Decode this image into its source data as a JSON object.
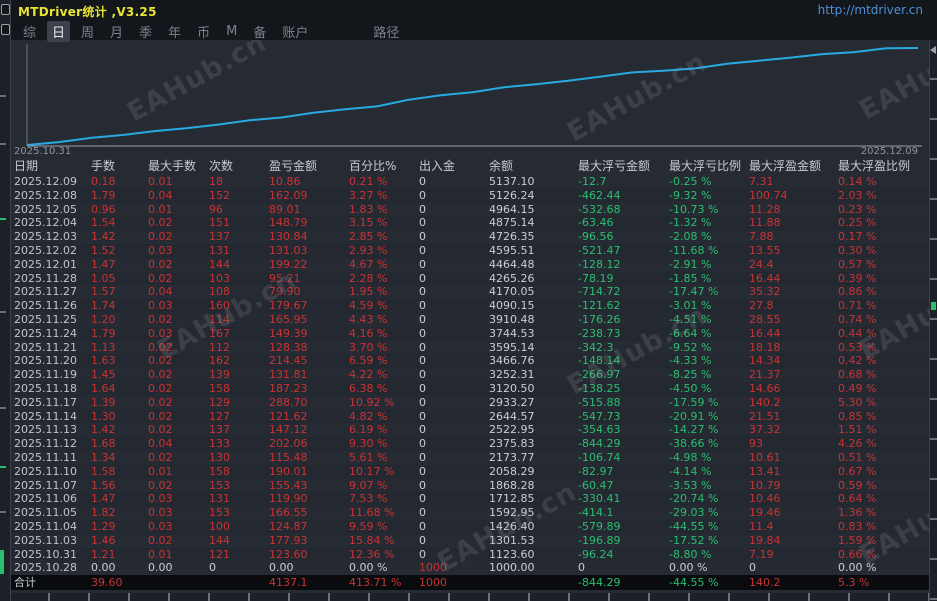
{
  "titlebar": {
    "title": "MTDriver统计 ,V3.25",
    "url": "http://mtdriver.cn"
  },
  "menu": {
    "items": [
      "综",
      "日",
      "周",
      "月",
      "季",
      "年",
      "币",
      "M",
      "备",
      "账户"
    ],
    "active": "日",
    "path_label": "路径"
  },
  "watermark": {
    "text": "EAHub.cn"
  },
  "chart_data": {
    "type": "line",
    "title": "账户余额曲线",
    "legend": "none",
    "grid": false,
    "line_color": "#29a9e1",
    "x_start_label": "2025.10.31",
    "x_end_label": "2025.12.09",
    "ylim": [
      1000,
      5137.1
    ],
    "dates": [
      "2025.10.28",
      "2025.10.31",
      "2025.11.03",
      "2025.11.04",
      "2025.11.05",
      "2025.11.06",
      "2025.11.07",
      "2025.11.10",
      "2025.11.11",
      "2025.11.12",
      "2025.11.13",
      "2025.11.14",
      "2025.11.17",
      "2025.11.18",
      "2025.11.19",
      "2025.11.20",
      "2025.11.21",
      "2025.11.24",
      "2025.11.25",
      "2025.11.26",
      "2025.11.27",
      "2025.11.28",
      "2025.12.01",
      "2025.12.02",
      "2025.12.03",
      "2025.12.04",
      "2025.12.05",
      "2025.12.08",
      "2025.12.09"
    ],
    "balances": [
      1000.0,
      1123.6,
      1301.53,
      1426.4,
      1592.95,
      1712.85,
      1868.28,
      2058.29,
      2173.77,
      2375.83,
      2522.95,
      2644.57,
      2933.27,
      3120.5,
      3252.31,
      3466.76,
      3595.14,
      3744.53,
      3910.48,
      4090.15,
      4170.05,
      4265.26,
      4464.48,
      4595.51,
      4726.35,
      4875.14,
      4964.15,
      5126.24,
      5137.1
    ]
  },
  "table": {
    "headers": [
      "日期",
      "手数",
      "最大手数",
      "次数",
      "盈亏金额",
      "百分比%",
      "出入金",
      "余额",
      "最大浮亏金额",
      "最大浮亏比例",
      "最大浮盈金额",
      "最大浮盈比例"
    ],
    "rows": [
      {
        "date": "2025.12.09",
        "lots": "0.18",
        "max_lots": "0.01",
        "count": "18",
        "profit": "10.86",
        "pct": "0.21 %",
        "cash_flow": "0",
        "balance": "5137.10",
        "max_float_loss": "-12.7",
        "max_float_loss_pct": "-0.25 %",
        "max_float_profit": "7.31",
        "max_float_profit_pct": "0.14 %"
      },
      {
        "date": "2025.12.08",
        "lots": "1.79",
        "max_lots": "0.04",
        "count": "152",
        "profit": "162.09",
        "pct": "3.27 %",
        "cash_flow": "0",
        "balance": "5126.24",
        "max_float_loss": "-462.44",
        "max_float_loss_pct": "-9.32 %",
        "max_float_profit": "100.74",
        "max_float_profit_pct": "2.03 %"
      },
      {
        "date": "2025.12.05",
        "lots": "0.96",
        "max_lots": "0.01",
        "count": "96",
        "profit": "89.01",
        "pct": "1.83 %",
        "cash_flow": "0",
        "balance": "4964.15",
        "max_float_loss": "-532.68",
        "max_float_loss_pct": "-10.73 %",
        "max_float_profit": "11.28",
        "max_float_profit_pct": "0.23 %"
      },
      {
        "date": "2025.12.04",
        "lots": "1.54",
        "max_lots": "0.02",
        "count": "151",
        "profit": "148.79",
        "pct": "3.15 %",
        "cash_flow": "0",
        "balance": "4875.14",
        "max_float_loss": "-63.46",
        "max_float_loss_pct": "-1.32 %",
        "max_float_profit": "11.88",
        "max_float_profit_pct": "0.25 %"
      },
      {
        "date": "2025.12.03",
        "lots": "1.42",
        "max_lots": "0.02",
        "count": "137",
        "profit": "130.84",
        "pct": "2.85 %",
        "cash_flow": "0",
        "balance": "4726.35",
        "max_float_loss": "-96.56",
        "max_float_loss_pct": "-2.08 %",
        "max_float_profit": "7.88",
        "max_float_profit_pct": "0.17 %"
      },
      {
        "date": "2025.12.02",
        "lots": "1.52",
        "max_lots": "0.03",
        "count": "131",
        "profit": "131.03",
        "pct": "2.93 %",
        "cash_flow": "0",
        "balance": "4595.51",
        "max_float_loss": "-521.47",
        "max_float_loss_pct": "-11.68 %",
        "max_float_profit": "13.55",
        "max_float_profit_pct": "0.30 %"
      },
      {
        "date": "2025.12.01",
        "lots": "1.47",
        "max_lots": "0.02",
        "count": "144",
        "profit": "199.22",
        "pct": "4.67 %",
        "cash_flow": "0",
        "balance": "4464.48",
        "max_float_loss": "-128.12",
        "max_float_loss_pct": "-2.91 %",
        "max_float_profit": "24.4",
        "max_float_profit_pct": "0.57 %"
      },
      {
        "date": "2025.11.28",
        "lots": "1.05",
        "max_lots": "0.02",
        "count": "103",
        "profit": "95.21",
        "pct": "2.28 %",
        "cash_flow": "0",
        "balance": "4265.26",
        "max_float_loss": "-78.19",
        "max_float_loss_pct": "-1.85 %",
        "max_float_profit": "16.44",
        "max_float_profit_pct": "0.39 %"
      },
      {
        "date": "2025.11.27",
        "lots": "1.57",
        "max_lots": "0.04",
        "count": "108",
        "profit": "79.90",
        "pct": "1.95 %",
        "cash_flow": "0",
        "balance": "4170.05",
        "max_float_loss": "-714.72",
        "max_float_loss_pct": "-17.47 %",
        "max_float_profit": "35.32",
        "max_float_profit_pct": "0.86 %"
      },
      {
        "date": "2025.11.26",
        "lots": "1.74",
        "max_lots": "0.03",
        "count": "160",
        "profit": "179.67",
        "pct": "4.59 %",
        "cash_flow": "0",
        "balance": "4090.15",
        "max_float_loss": "-121.62",
        "max_float_loss_pct": "-3.01 %",
        "max_float_profit": "27.8",
        "max_float_profit_pct": "0.71 %"
      },
      {
        "date": "2025.11.25",
        "lots": "1.20",
        "max_lots": "0.02",
        "count": "114",
        "profit": "165.95",
        "pct": "4.43 %",
        "cash_flow": "0",
        "balance": "3910.48",
        "max_float_loss": "-176.26",
        "max_float_loss_pct": "-4.51 %",
        "max_float_profit": "28.55",
        "max_float_profit_pct": "0.74 %"
      },
      {
        "date": "2025.11.24",
        "lots": "1.79",
        "max_lots": "0.03",
        "count": "167",
        "profit": "149.39",
        "pct": "4.16 %",
        "cash_flow": "0",
        "balance": "3744.53",
        "max_float_loss": "-238.73",
        "max_float_loss_pct": "-6.64 %",
        "max_float_profit": "16.44",
        "max_float_profit_pct": "0.44 %"
      },
      {
        "date": "2025.11.21",
        "lots": "1.13",
        "max_lots": "0.02",
        "count": "112",
        "profit": "128.38",
        "pct": "3.70 %",
        "cash_flow": "0",
        "balance": "3595.14",
        "max_float_loss": "-342.3",
        "max_float_loss_pct": "-9.52 %",
        "max_float_profit": "18.18",
        "max_float_profit_pct": "0.53 %"
      },
      {
        "date": "2025.11.20",
        "lots": "1.63",
        "max_lots": "0.02",
        "count": "162",
        "profit": "214.45",
        "pct": "6.59 %",
        "cash_flow": "0",
        "balance": "3466.76",
        "max_float_loss": "-148.14",
        "max_float_loss_pct": "-4.33 %",
        "max_float_profit": "14.34",
        "max_float_profit_pct": "0.42 %"
      },
      {
        "date": "2025.11.19",
        "lots": "1.45",
        "max_lots": "0.02",
        "count": "139",
        "profit": "131.81",
        "pct": "4.22 %",
        "cash_flow": "0",
        "balance": "3252.31",
        "max_float_loss": "-266.97",
        "max_float_loss_pct": "-8.25 %",
        "max_float_profit": "21.37",
        "max_float_profit_pct": "0.68 %"
      },
      {
        "date": "2025.11.18",
        "lots": "1.64",
        "max_lots": "0.02",
        "count": "158",
        "profit": "187.23",
        "pct": "6.38 %",
        "cash_flow": "0",
        "balance": "3120.50",
        "max_float_loss": "-138.25",
        "max_float_loss_pct": "-4.50 %",
        "max_float_profit": "14.66",
        "max_float_profit_pct": "0.49 %"
      },
      {
        "date": "2025.11.17",
        "lots": "1.39",
        "max_lots": "0.02",
        "count": "129",
        "profit": "288.70",
        "pct": "10.92 %",
        "cash_flow": "0",
        "balance": "2933.27",
        "max_float_loss": "-515.88",
        "max_float_loss_pct": "-17.59 %",
        "max_float_profit": "140.2",
        "max_float_profit_pct": "5.30 %"
      },
      {
        "date": "2025.11.14",
        "lots": "1.30",
        "max_lots": "0.02",
        "count": "127",
        "profit": "121.62",
        "pct": "4.82 %",
        "cash_flow": "0",
        "balance": "2644.57",
        "max_float_loss": "-547.73",
        "max_float_loss_pct": "-20.91 %",
        "max_float_profit": "21.51",
        "max_float_profit_pct": "0.85 %"
      },
      {
        "date": "2025.11.13",
        "lots": "1.42",
        "max_lots": "0.02",
        "count": "137",
        "profit": "147.12",
        "pct": "6.19 %",
        "cash_flow": "0",
        "balance": "2522.95",
        "max_float_loss": "-354.63",
        "max_float_loss_pct": "-14.27 %",
        "max_float_profit": "37.32",
        "max_float_profit_pct": "1.51 %"
      },
      {
        "date": "2025.11.12",
        "lots": "1.68",
        "max_lots": "0.04",
        "count": "133",
        "profit": "202.06",
        "pct": "9.30 %",
        "cash_flow": "0",
        "balance": "2375.83",
        "max_float_loss": "-844.29",
        "max_float_loss_pct": "-38.66 %",
        "max_float_profit": "93",
        "max_float_profit_pct": "4.26 %"
      },
      {
        "date": "2025.11.11",
        "lots": "1.34",
        "max_lots": "0.02",
        "count": "130",
        "profit": "115.48",
        "pct": "5.61 %",
        "cash_flow": "0",
        "balance": "2173.77",
        "max_float_loss": "-106.74",
        "max_float_loss_pct": "-4.98 %",
        "max_float_profit": "10.61",
        "max_float_profit_pct": "0.51 %"
      },
      {
        "date": "2025.11.10",
        "lots": "1.58",
        "max_lots": "0.01",
        "count": "158",
        "profit": "190.01",
        "pct": "10.17 %",
        "cash_flow": "0",
        "balance": "2058.29",
        "max_float_loss": "-82.97",
        "max_float_loss_pct": "-4.14 %",
        "max_float_profit": "13.41",
        "max_float_profit_pct": "0.67 %"
      },
      {
        "date": "2025.11.07",
        "lots": "1.56",
        "max_lots": "0.02",
        "count": "153",
        "profit": "155.43",
        "pct": "9.07 %",
        "cash_flow": "0",
        "balance": "1868.28",
        "max_float_loss": "-60.47",
        "max_float_loss_pct": "-3.53 %",
        "max_float_profit": "10.79",
        "max_float_profit_pct": "0.59 %"
      },
      {
        "date": "2025.11.06",
        "lots": "1.47",
        "max_lots": "0.03",
        "count": "131",
        "profit": "119.90",
        "pct": "7.53 %",
        "cash_flow": "0",
        "balance": "1712.85",
        "max_float_loss": "-330.41",
        "max_float_loss_pct": "-20.74 %",
        "max_float_profit": "10.46",
        "max_float_profit_pct": "0.64 %"
      },
      {
        "date": "2025.11.05",
        "lots": "1.82",
        "max_lots": "0.03",
        "count": "153",
        "profit": "166.55",
        "pct": "11.68 %",
        "cash_flow": "0",
        "balance": "1592.95",
        "max_float_loss": "-414.1",
        "max_float_loss_pct": "-29.03 %",
        "max_float_profit": "19.46",
        "max_float_profit_pct": "1.36 %"
      },
      {
        "date": "2025.11.04",
        "lots": "1.29",
        "max_lots": "0.03",
        "count": "100",
        "profit": "124.87",
        "pct": "9.59 %",
        "cash_flow": "0",
        "balance": "1426.40",
        "max_float_loss": "-579.89",
        "max_float_loss_pct": "-44.55 %",
        "max_float_profit": "11.4",
        "max_float_profit_pct": "0.83 %"
      },
      {
        "date": "2025.11.03",
        "lots": "1.46",
        "max_lots": "0.02",
        "count": "144",
        "profit": "177.93",
        "pct": "15.84 %",
        "cash_flow": "0",
        "balance": "1301.53",
        "max_float_loss": "-196.89",
        "max_float_loss_pct": "-17.52 %",
        "max_float_profit": "19.84",
        "max_float_profit_pct": "1.59 %"
      },
      {
        "date": "2025.10.31",
        "lots": "1.21",
        "max_lots": "0.01",
        "count": "121",
        "profit": "123.60",
        "pct": "12.36 %",
        "cash_flow": "0",
        "balance": "1123.60",
        "max_float_loss": "-96.24",
        "max_float_loss_pct": "-8.80 %",
        "max_float_profit": "7.19",
        "max_float_profit_pct": "0.66 %"
      },
      {
        "date": "2025.10.28",
        "lots": "0.00",
        "max_lots": "0.00",
        "count": "0",
        "profit": "0.00",
        "pct": "0.00 %",
        "cash_flow": "1000",
        "balance": "1000.00",
        "max_float_loss": "0",
        "max_float_loss_pct": "0.00 %",
        "max_float_profit": "0",
        "max_float_profit_pct": "0.00 %",
        "muted": true
      }
    ],
    "total": {
      "date": "合计",
      "lots": "39.60",
      "max_lots": "",
      "count": "",
      "profit": "4137.1",
      "pct": "413.71 %",
      "cash_flow": "1000",
      "balance": "",
      "max_float_loss": "-844.29",
      "max_float_loss_pct": "-44.55 %",
      "max_float_profit": "140.2",
      "max_float_profit_pct": "5.3 %"
    }
  }
}
